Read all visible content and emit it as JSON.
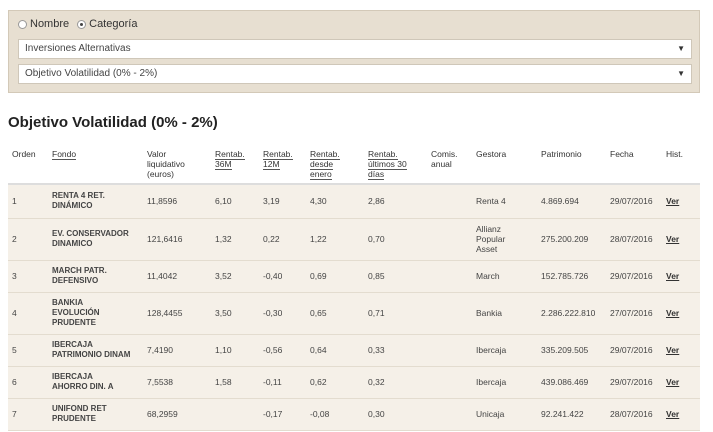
{
  "filter": {
    "radio_nombre": "Nombre",
    "radio_categoria": "Categoría",
    "selected_radio": "categoria",
    "select_type": "Inversiones Alternativas",
    "select_category": "Objetivo Volatilidad (0% - 2%)"
  },
  "page_title": "Objetivo Volatilidad (0% - 2%)",
  "table": {
    "headers": {
      "orden": "Orden",
      "fondo": "Fondo",
      "valor": [
        "Valor",
        "liquidativo",
        "(euros)"
      ],
      "rent36": [
        "Rentab.",
        "36M"
      ],
      "rent12": [
        "Rentab.",
        "12M"
      ],
      "rentEnero": [
        "Rentab.",
        "desde",
        "enero"
      ],
      "rent30": [
        "Rentab.",
        "últimos 30",
        "días"
      ],
      "comis": [
        "Comis.",
        "anual"
      ],
      "gestora": "Gestora",
      "patrimonio": "Patrimonio",
      "fecha": "Fecha",
      "hist": "Hist."
    },
    "rows": [
      {
        "orden": "1",
        "fondo": [
          "RENTA 4 RET.",
          "DINÁMICO"
        ],
        "valor": "11,8596",
        "rent36": "6,10",
        "rent12": "3,19",
        "rentEnero": "4,30",
        "rent30": "2,86",
        "comis": "",
        "gestora": [
          "Renta 4"
        ],
        "patrimonio": "4.869.694",
        "fecha": "29/07/2016",
        "hist": "Ver"
      },
      {
        "orden": "2",
        "fondo": [
          "EV. CONSERVADOR",
          "DINAMICO"
        ],
        "valor": "121,6416",
        "rent36": "1,32",
        "rent12": "0,22",
        "rentEnero": "1,22",
        "rent30": "0,70",
        "comis": "",
        "gestora": [
          "Allianz",
          "Popular",
          "Asset"
        ],
        "patrimonio": "275.200.209",
        "fecha": "28/07/2016",
        "hist": "Ver"
      },
      {
        "orden": "3",
        "fondo": [
          "MARCH PATR.",
          "DEFENSIVO"
        ],
        "valor": "11,4042",
        "rent36": "3,52",
        "rent12": "-0,40",
        "rentEnero": "0,69",
        "rent30": "0,85",
        "comis": "",
        "gestora": [
          "March"
        ],
        "patrimonio": "152.785.726",
        "fecha": "29/07/2016",
        "hist": "Ver"
      },
      {
        "orden": "4",
        "fondo": [
          "BANKIA",
          "EVOLUCIÓN",
          "PRUDENTE"
        ],
        "valor": "128,4455",
        "rent36": "3,50",
        "rent12": "-0,30",
        "rentEnero": "0,65",
        "rent30": "0,71",
        "comis": "",
        "gestora": [
          "Bankia"
        ],
        "patrimonio": "2.286.222.810",
        "fecha": "27/07/2016",
        "hist": "Ver"
      },
      {
        "orden": "5",
        "fondo": [
          "IBERCAJA",
          "PATRIMONIO DINAM"
        ],
        "valor": "7,4190",
        "rent36": "1,10",
        "rent12": "-0,56",
        "rentEnero": "0,64",
        "rent30": "0,33",
        "comis": "",
        "gestora": [
          "Ibercaja"
        ],
        "patrimonio": "335.209.505",
        "fecha": "29/07/2016",
        "hist": "Ver"
      },
      {
        "orden": "6",
        "fondo": [
          "IBERCAJA",
          "AHORRO DIN. A"
        ],
        "valor": "7,5538",
        "rent36": "1,58",
        "rent12": "-0,11",
        "rentEnero": "0,62",
        "rent30": "0,32",
        "comis": "",
        "gestora": [
          "Ibercaja"
        ],
        "patrimonio": "439.086.469",
        "fecha": "29/07/2016",
        "hist": "Ver"
      },
      {
        "orden": "7",
        "fondo": [
          "UNIFOND RET",
          "PRUDENTE"
        ],
        "valor": "68,2959",
        "rent36": "",
        "rent12": "-0,17",
        "rentEnero": "-0,08",
        "rent30": "0,30",
        "comis": "",
        "gestora": [
          "Unicaja"
        ],
        "patrimonio": "92.241.422",
        "fecha": "28/07/2016",
        "hist": "Ver"
      }
    ]
  }
}
